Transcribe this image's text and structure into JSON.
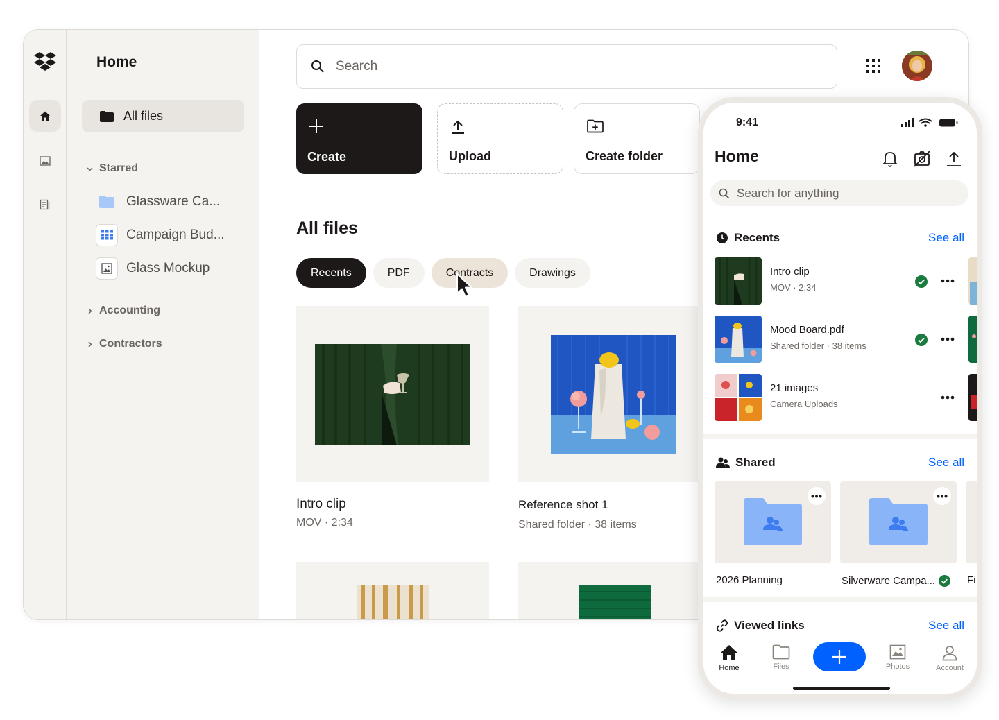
{
  "sidebar": {
    "title": "Home",
    "all_files": "All files",
    "starred_label": "Starred",
    "starred_items": [
      "Glassware Ca...",
      "Campaign Bud...",
      "Glass Mockup"
    ],
    "sections": [
      "Accounting",
      "Contractors"
    ]
  },
  "search": {
    "placeholder": "Search"
  },
  "actions": {
    "create": "Create",
    "upload": "Upload",
    "create_folder": "Create folder"
  },
  "main": {
    "section_title": "All files",
    "filters": [
      "Recents",
      "PDF",
      "Contracts",
      "Drawings"
    ],
    "active_filter": "Recents",
    "files": [
      {
        "title": "Intro clip",
        "subtitle": "MOV · 2:34"
      },
      {
        "title": "Reference shot 1",
        "subtitle": "Shared folder ·  38 items"
      }
    ]
  },
  "phone": {
    "time": "9:41",
    "title": "Home",
    "search_placeholder": "Search for anything",
    "recents_label": "Recents",
    "see_all": "See all",
    "recents": [
      {
        "name": "Intro clip",
        "sub": "MOV · 2:34",
        "synced": true
      },
      {
        "name": "Mood Board.pdf",
        "sub": "Shared folder ·  38 items",
        "synced": true
      },
      {
        "name": "21 images",
        "sub": "Camera Uploads",
        "synced": false
      }
    ],
    "shared_label": "Shared",
    "shared": [
      {
        "name": "2026 Planning",
        "synced": false
      },
      {
        "name": "Silverware Campa...",
        "synced": true
      },
      {
        "name": "Fi"
      }
    ],
    "viewed_links_label": "Viewed links",
    "tabs": [
      "Home",
      "Files",
      "Photos",
      "Account"
    ],
    "active_tab": "Home"
  },
  "colors": {
    "accent": "#0061fe",
    "dark": "#1e1919",
    "panel": "#f5f3f0",
    "success": "#1b7a3d"
  }
}
